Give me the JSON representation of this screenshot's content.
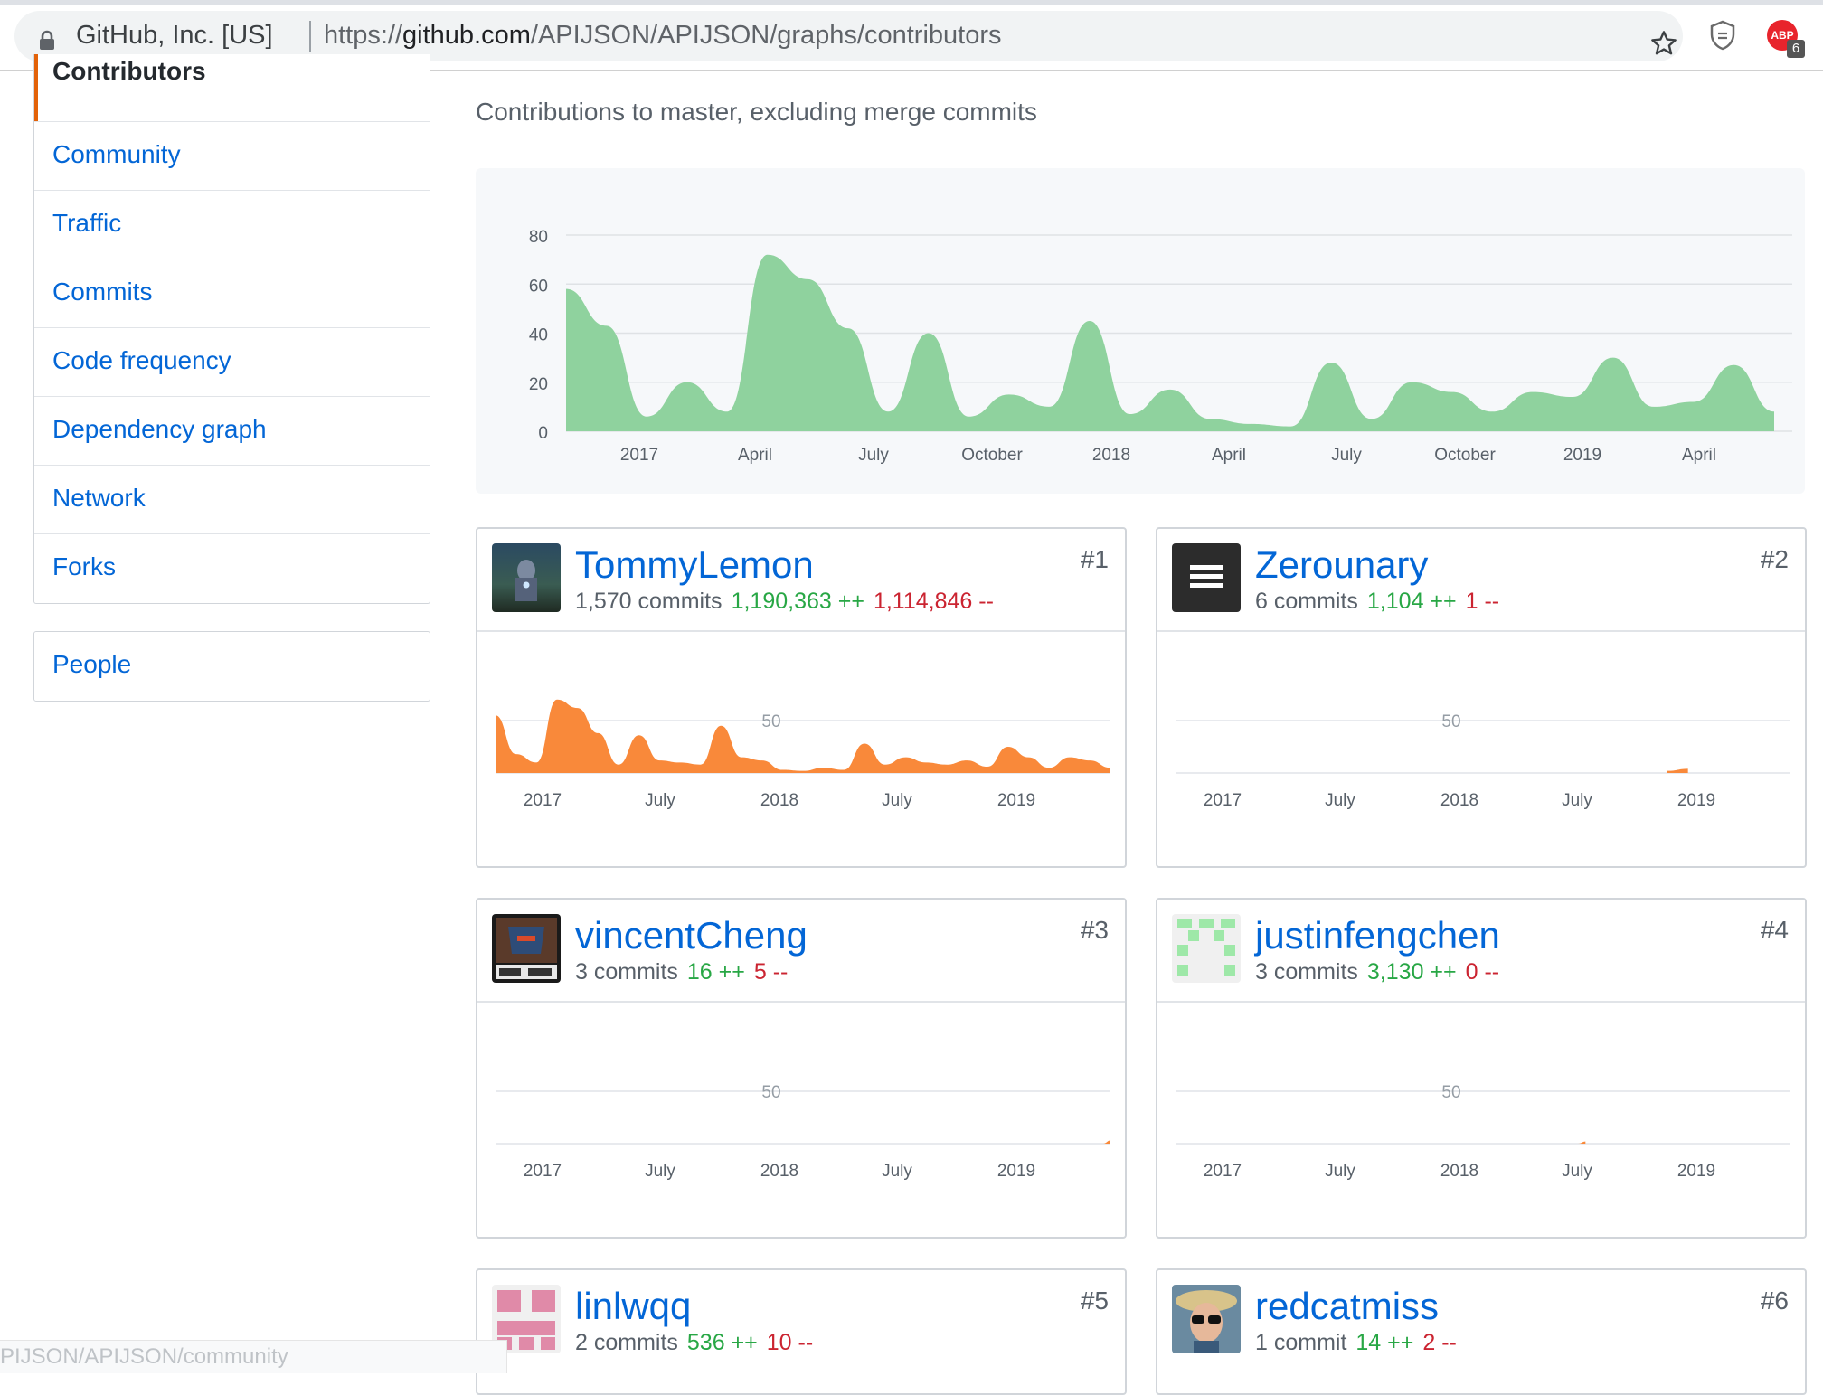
{
  "browser": {
    "site_owner": "GitHub, Inc. [US]",
    "url_scheme": "https://",
    "url_host": "github.com",
    "url_path": "/APIJSON/APIJSON/graphs/contributors",
    "abp_label": "ABP",
    "abp_count": "6",
    "icons": [
      "lock-icon",
      "star-icon",
      "shield-extension-icon",
      "adblock-icon"
    ]
  },
  "sidebar": {
    "items": [
      {
        "label": "Contributors",
        "selected": true
      },
      {
        "label": "Community"
      },
      {
        "label": "Traffic"
      },
      {
        "label": "Commits"
      },
      {
        "label": "Code frequency"
      },
      {
        "label": "Dependency graph"
      },
      {
        "label": "Network"
      },
      {
        "label": "Forks"
      }
    ],
    "people_label": "People"
  },
  "main": {
    "subtitle": "Contributions to master, excluding merge commits"
  },
  "chart_data": [
    {
      "type": "area",
      "color": "#8fd29e",
      "yticks": [
        "80",
        "60",
        "40",
        "20",
        "0"
      ],
      "ylim": [
        0,
        80
      ],
      "xticks": [
        "2017",
        "April",
        "July",
        "October",
        "2018",
        "April",
        "July",
        "October",
        "2019",
        "April"
      ],
      "x": [
        "2016-11",
        "2016-12",
        "2017-01",
        "2017-02",
        "2017-03",
        "2017-04",
        "2017-05",
        "2017-06",
        "2017-07",
        "2017-08",
        "2017-09",
        "2017-10",
        "2017-11",
        "2017-12",
        "2018-01",
        "2018-02",
        "2018-03",
        "2018-04",
        "2018-05",
        "2018-06",
        "2018-07",
        "2018-08",
        "2018-09",
        "2018-10",
        "2018-11",
        "2018-12",
        "2019-01",
        "2019-02",
        "2019-03",
        "2019-04",
        "2019-05"
      ],
      "values": [
        58,
        43,
        6,
        20,
        8,
        72,
        62,
        42,
        8,
        40,
        6,
        15,
        10,
        45,
        7,
        17,
        5,
        3,
        2,
        28,
        5,
        20,
        16,
        8,
        16,
        14,
        30,
        10,
        12,
        27,
        8
      ]
    },
    {
      "type": "area",
      "color": "#f9893a",
      "contributor": "TommyLemon",
      "ytick": "50",
      "xticks": [
        "2017",
        "July",
        "2018",
        "July",
        "2019"
      ],
      "x": [
        "2016-11",
        "2016-12",
        "2017-01",
        "2017-02",
        "2017-03",
        "2017-04",
        "2017-05",
        "2017-06",
        "2017-07",
        "2017-08",
        "2017-09",
        "2017-10",
        "2017-11",
        "2017-12",
        "2018-01",
        "2018-02",
        "2018-03",
        "2018-04",
        "2018-05",
        "2018-06",
        "2018-07",
        "2018-08",
        "2018-09",
        "2018-10",
        "2018-11",
        "2018-12",
        "2019-01",
        "2019-02",
        "2019-03",
        "2019-04",
        "2019-05"
      ],
      "values": [
        55,
        18,
        10,
        70,
        62,
        38,
        8,
        36,
        12,
        10,
        8,
        45,
        15,
        12,
        3,
        2,
        5,
        3,
        28,
        8,
        15,
        10,
        8,
        12,
        6,
        25,
        15,
        5,
        15,
        12,
        5
      ]
    },
    {
      "type": "area",
      "color": "#f9893a",
      "contributor": "Zerounary",
      "ytick": "50",
      "xticks": [
        "2017",
        "July",
        "2018",
        "July",
        "2019"
      ],
      "x": [
        "2018-11",
        "2018-12"
      ],
      "values": [
        2,
        4
      ]
    },
    {
      "type": "area",
      "color": "#f9893a",
      "contributor": "vincentCheng",
      "ytick": "50",
      "xticks": [
        "2017",
        "July",
        "2018",
        "July",
        "2019"
      ],
      "x": [
        "2019-05"
      ],
      "values": [
        3
      ]
    },
    {
      "type": "area",
      "color": "#f9893a",
      "contributor": "justinfengchen",
      "ytick": "50",
      "xticks": [
        "2017",
        "July",
        "2018",
        "July",
        "2019"
      ],
      "x": [
        "2018-07"
      ],
      "values": [
        2
      ]
    }
  ],
  "contributors": [
    {
      "name": "TommyLemon",
      "rank": "#1",
      "commits": "1,570 commits",
      "additions": "1,190,363 ++",
      "deletions": "1,114,846 --"
    },
    {
      "name": "Zerounary",
      "rank": "#2",
      "commits": "6 commits",
      "additions": "1,104 ++",
      "deletions": "1 --"
    },
    {
      "name": "vincentCheng",
      "rank": "#3",
      "commits": "3 commits",
      "additions": "16 ++",
      "deletions": "5 --"
    },
    {
      "name": "justinfengchen",
      "rank": "#4",
      "commits": "3 commits",
      "additions": "3,130 ++",
      "deletions": "0 --"
    },
    {
      "name": "linlwqq",
      "rank": "#5",
      "commits": "2 commits",
      "additions": "536 ++",
      "deletions": "10 --"
    },
    {
      "name": "redcatmiss",
      "rank": "#6",
      "commits": "1 commit",
      "additions": "14 ++",
      "deletions": "2 --"
    }
  ],
  "status_bubble": "PIJSON/APIJSON/community"
}
